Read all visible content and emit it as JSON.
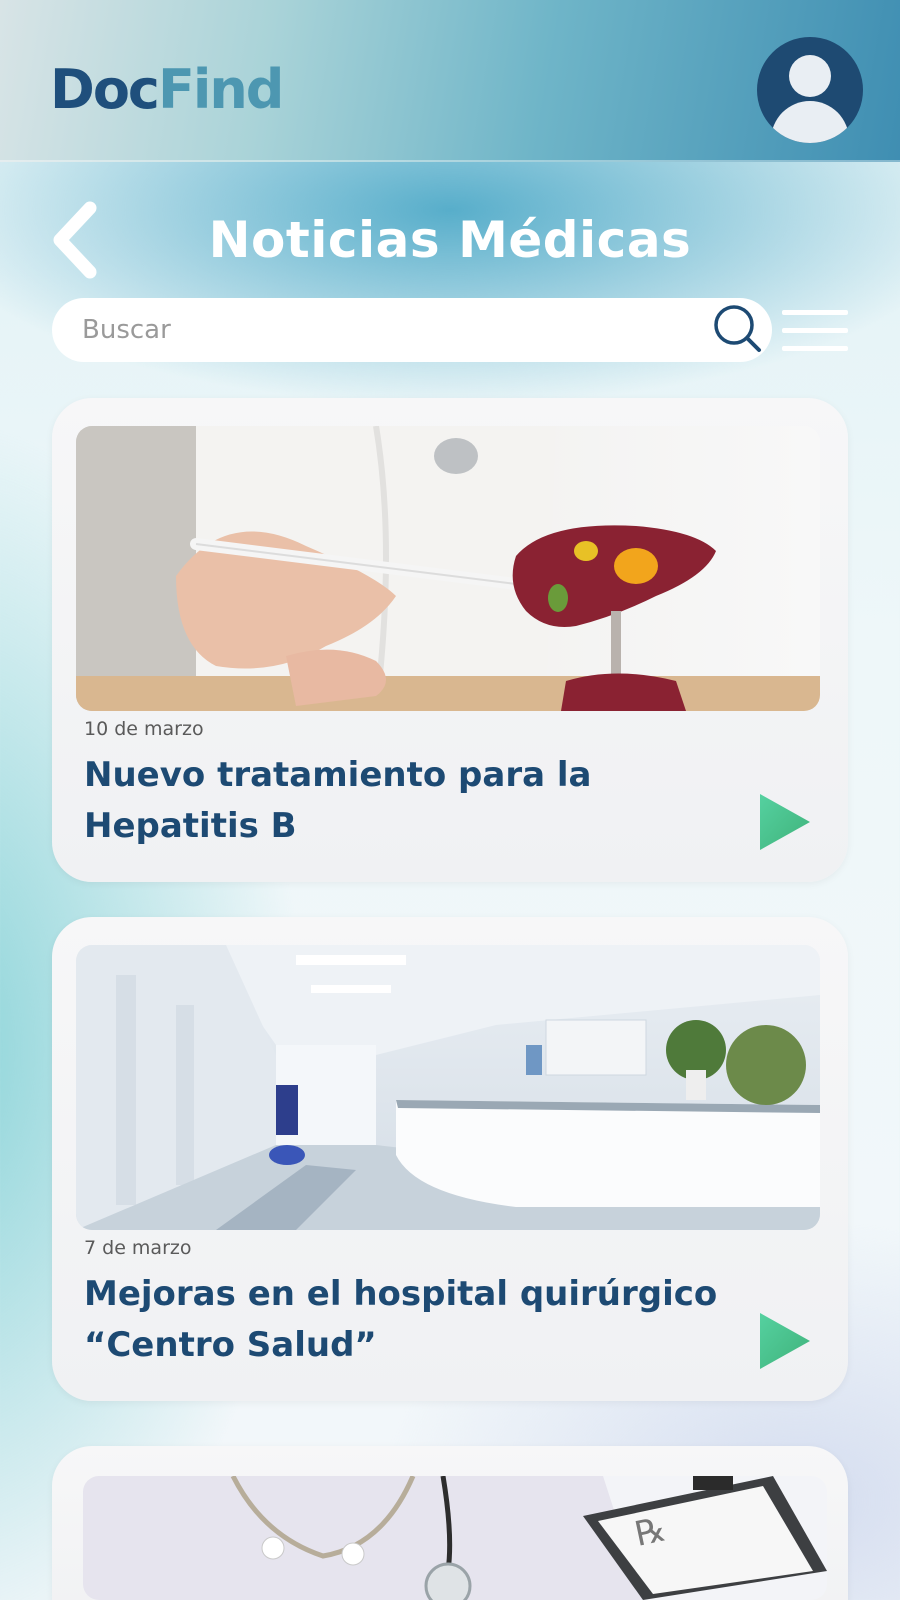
{
  "app": {
    "logo_part1": "Doc",
    "logo_part2": "Find"
  },
  "page": {
    "title": "Noticias Médicas"
  },
  "search": {
    "placeholder": "Buscar",
    "value": ""
  },
  "news": [
    {
      "date": "10 de marzo",
      "title": "Nuevo tratamiento para la Hepatitis B",
      "image": "doctor-holding-liver-model"
    },
    {
      "date": "7 de marzo",
      "title": "Mejoras en el hospital quirúrgico “Centro Salud”",
      "image": "hospital-reception-hallway"
    },
    {
      "date": "",
      "title": "",
      "image": "doctor-with-prescription-clipboard"
    }
  ],
  "icons": {
    "back": "chevron-left-icon",
    "search": "search-icon",
    "menu": "hamburger-menu-icon",
    "play": "play-icon",
    "avatar": "user-avatar-icon"
  },
  "colors": {
    "brand_dark": "#1f4f7c",
    "brand_light": "#4d97b1",
    "title_text": "#1d4a73",
    "play_green": "#49c489",
    "play_teal": "#6fd0b0"
  }
}
